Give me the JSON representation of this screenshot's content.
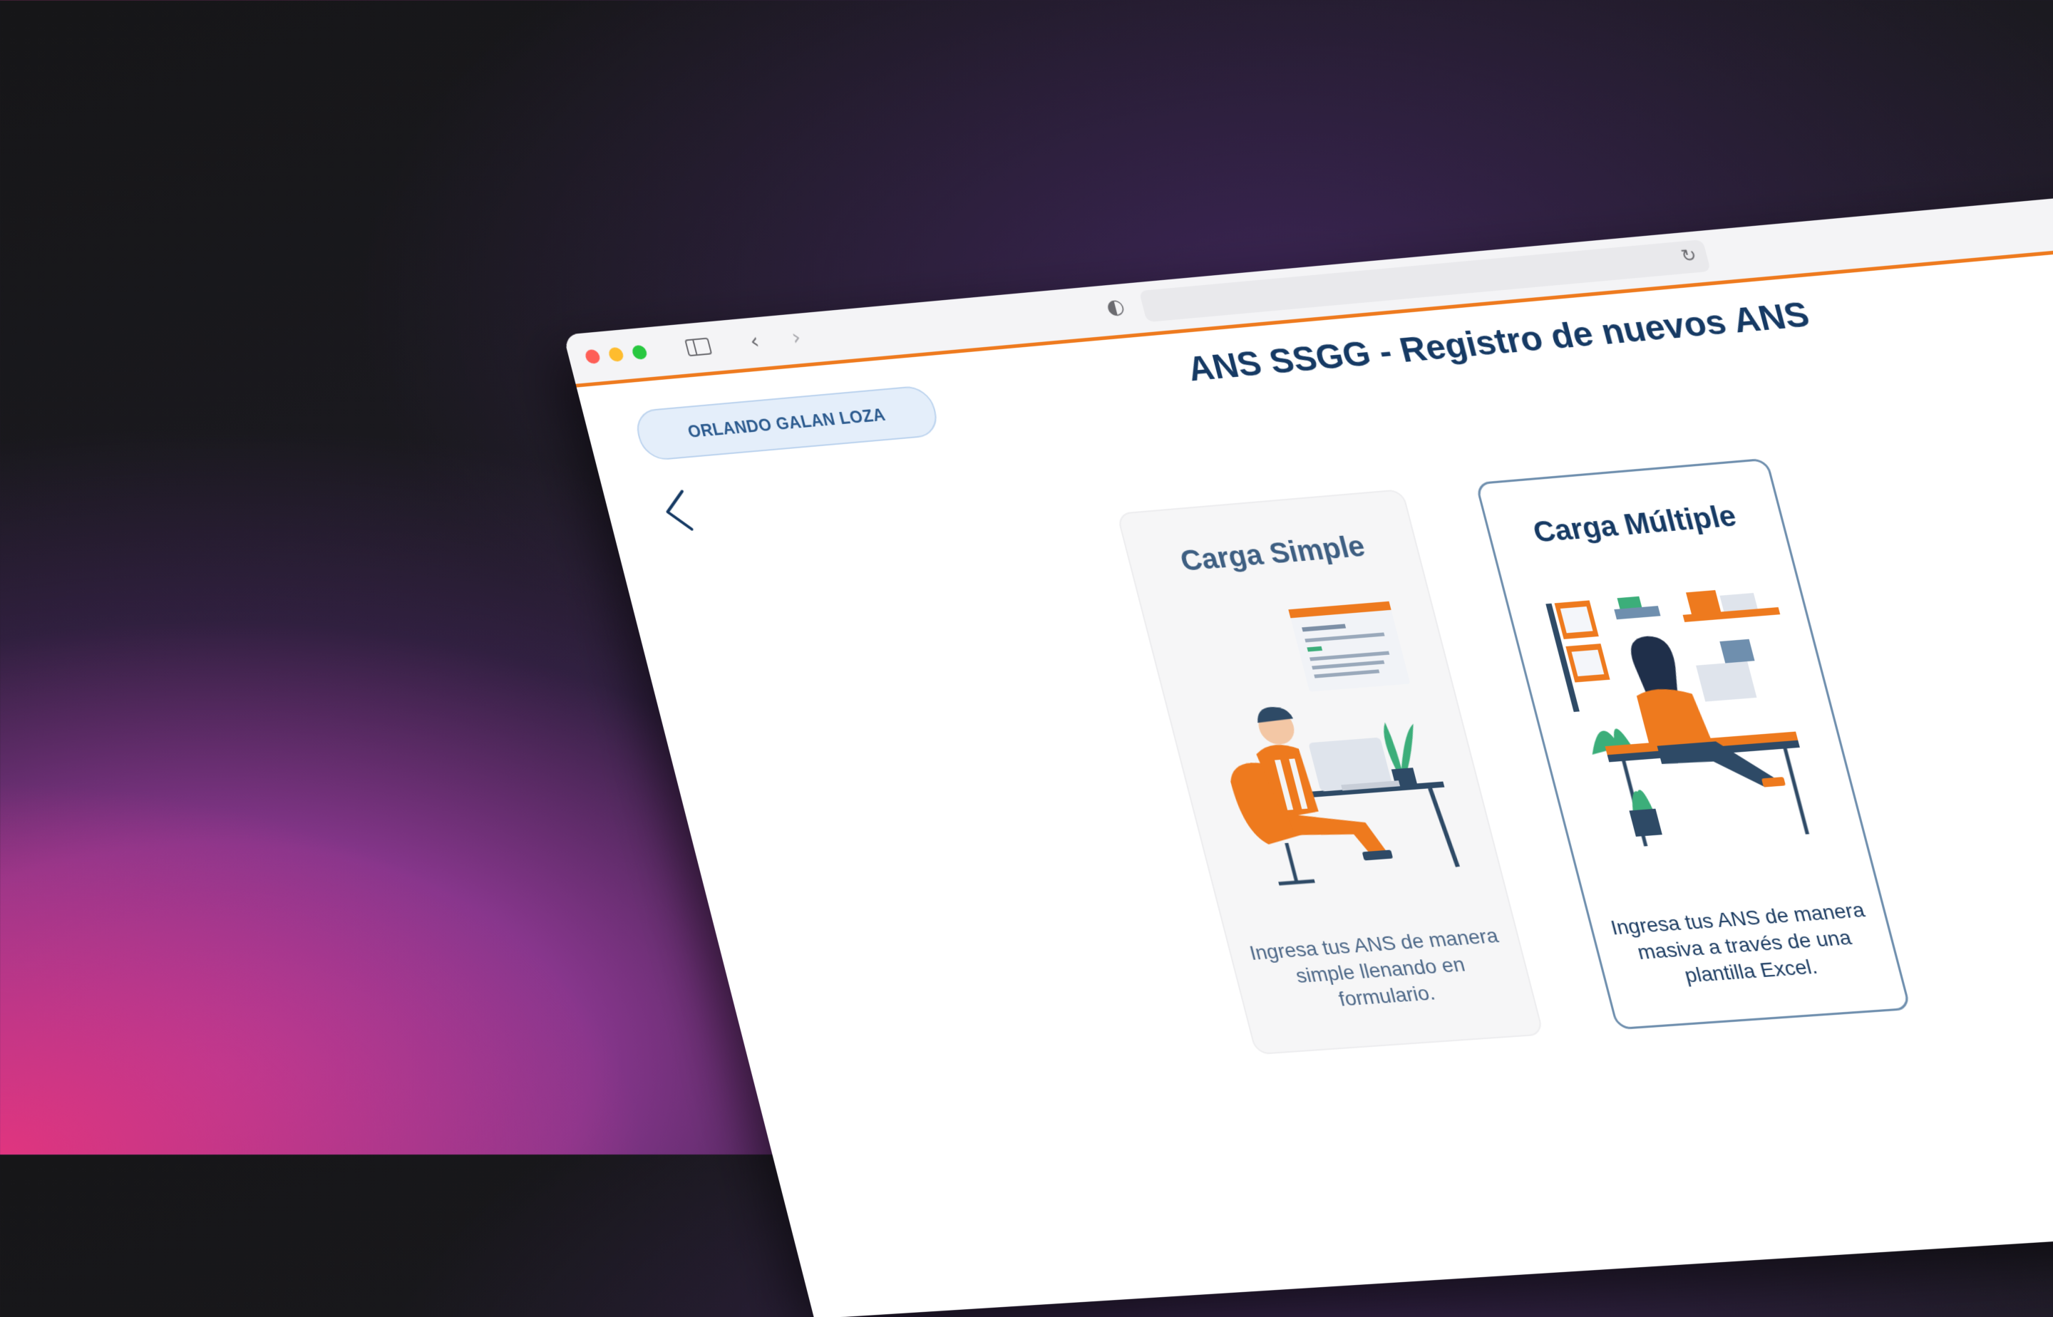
{
  "browser": {
    "toolbar": {
      "back_glyph": "‹",
      "forward_glyph": "›",
      "shield_glyph": "◐",
      "reload_glyph": "↻",
      "download_glyph": "⊕",
      "accent_color": "#ee7a1e"
    }
  },
  "header": {
    "user_name": "ORLANDO GALAN LOZA",
    "title": "ANS SSGG - Registro de nuevos ANS"
  },
  "cards": [
    {
      "title": "Carga Simple",
      "description": "Ingresa tus ANS de manera simple llenando en formulario.",
      "illustration": "man-at-laptop-illustration"
    },
    {
      "title": "Carga Múltiple",
      "description": "Ingresa tus ANS de manera masiva a través de una plantilla Excel.",
      "illustration": "woman-at-desk-illustration"
    }
  ],
  "colors": {
    "title": "#163a64",
    "orange": "#ee7a1e",
    "pill_bg": "#e4eefa"
  }
}
